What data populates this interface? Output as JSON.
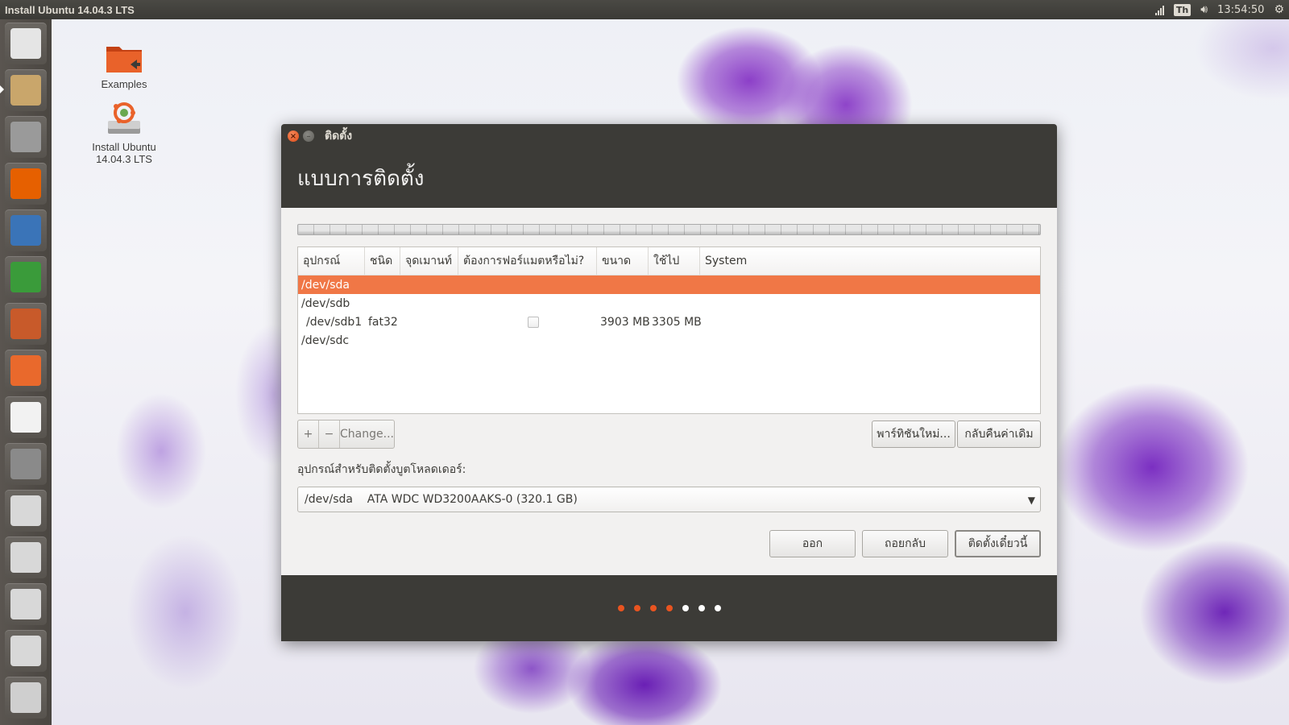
{
  "top_panel": {
    "title": "Install Ubuntu 14.04.3 LTS",
    "keyboard": "Th",
    "time": "13:54:50",
    "icons": [
      "network-signal-icon",
      "keyboard-layout-icon",
      "volume-icon",
      "clock",
      "gear-icon"
    ]
  },
  "launcher": {
    "items": [
      {
        "name": "dash-home-icon",
        "color": "#e5e5e5"
      },
      {
        "name": "ubiquity-installer-icon",
        "color": "#c9a66b"
      },
      {
        "name": "file-cabinet-icon",
        "color": "#9a9a9a"
      },
      {
        "name": "firefox-icon",
        "color": "#e66000"
      },
      {
        "name": "writer-icon",
        "color": "#3a74b8"
      },
      {
        "name": "calc-icon",
        "color": "#3a9b3a"
      },
      {
        "name": "impress-icon",
        "color": "#c85a2a"
      },
      {
        "name": "software-center-icon",
        "color": "#e9692c"
      },
      {
        "name": "amazon-icon",
        "color": "#f2f2f2"
      },
      {
        "name": "system-settings-icon",
        "color": "#8a8a8a"
      },
      {
        "name": "drive-icon",
        "color": "#d8d8d8"
      },
      {
        "name": "drive-icon",
        "color": "#d8d8d8"
      },
      {
        "name": "drive-icon",
        "color": "#d8d8d8"
      },
      {
        "name": "drive-icon",
        "color": "#d8d8d8"
      },
      {
        "name": "trash-icon",
        "color": "#cfcfcf"
      }
    ]
  },
  "desktop": {
    "examples_label": "Examples",
    "install_label_1": "Install Ubuntu",
    "install_label_2": "14.04.3 LTS"
  },
  "dialog": {
    "window_title": "ติดตั้ง",
    "header": "แบบการติดตั้ง",
    "columns": [
      "อุปกรณ์",
      "ชนิด",
      "จุดเมานท์",
      "ต้องการฟอร์แมตหรือไม่?",
      "ขนาด",
      "ใช้ไป",
      "System"
    ],
    "rows": [
      {
        "device": "/dev/sda",
        "type": "",
        "mount": "",
        "format": "",
        "size": "",
        "used": "",
        "system": "",
        "selected": true
      },
      {
        "device": "/dev/sdb",
        "type": "",
        "mount": "",
        "format": "",
        "size": "",
        "used": "",
        "system": "",
        "selected": false
      },
      {
        "device": " /dev/sdb1",
        "type": "fat32",
        "mount": "",
        "format": "checkbox",
        "size": "3903 MB",
        "used": "3305 MB",
        "system": "",
        "selected": false
      },
      {
        "device": "/dev/sdc",
        "type": "",
        "mount": "",
        "format": "",
        "size": "",
        "used": "",
        "system": "",
        "selected": false
      }
    ],
    "toolbar": {
      "add_label": "+",
      "remove_label": "−",
      "change_label": "Change...",
      "new_table_label": "พาร์ทิชันใหม่...",
      "revert_label": "กลับคืนค่าเดิม"
    },
    "bootloader_label": "อุปกรณ์สำหรับติดตั้งบูตโหลดเดอร์:",
    "bootloader_value": "/dev/sda    ATA WDC WD3200AAKS-0 (320.1 GB)",
    "buttons": {
      "quit": "ออก",
      "back": "ถอยกลับ",
      "install_now": "ติดตั้งเดี๋ยวนี้"
    },
    "progress": {
      "completed_steps": 4,
      "total_steps": 7,
      "active_color": "#e95420",
      "inactive_color": "#ffffff"
    }
  }
}
